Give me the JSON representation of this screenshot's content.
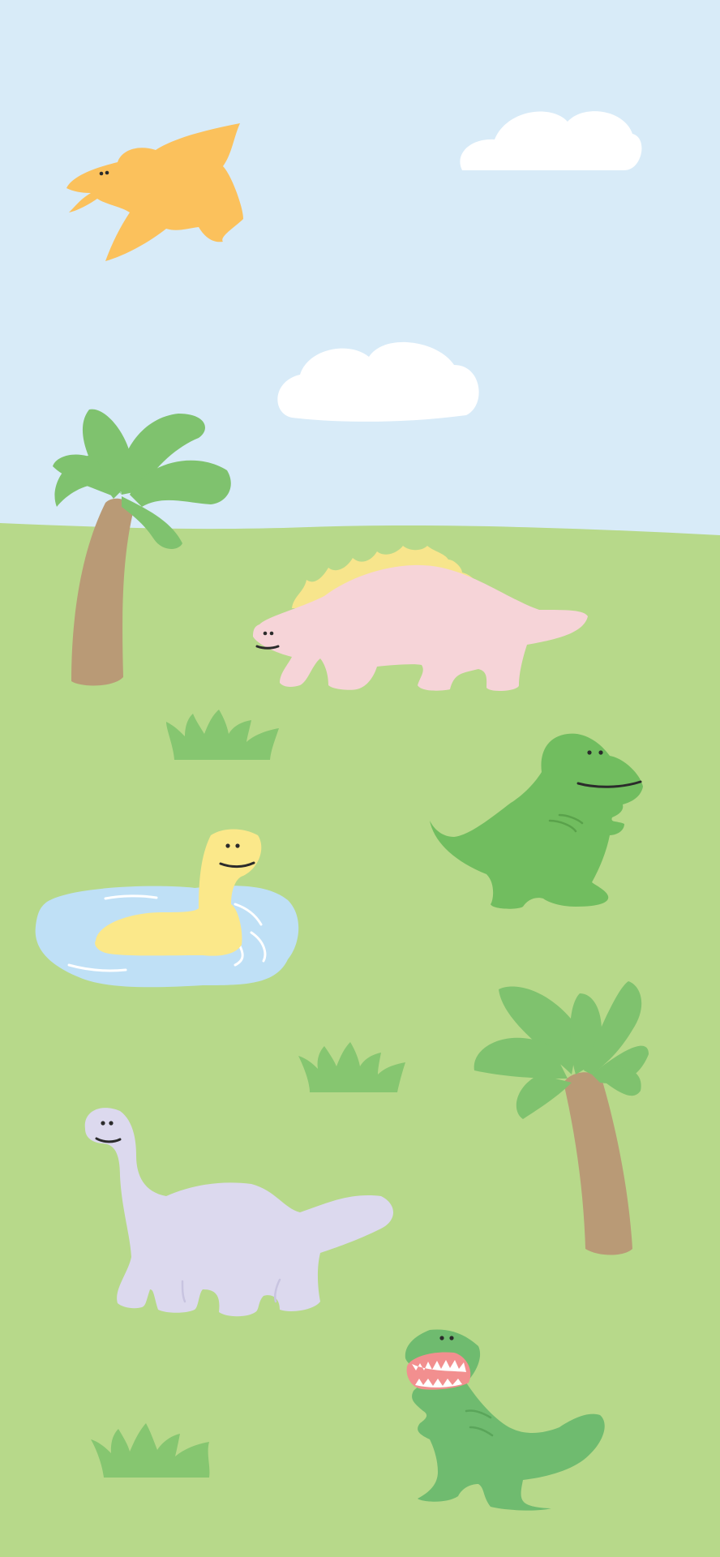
{
  "scene": {
    "colors": {
      "sky": "#d8ebf8",
      "grass": "#b7d98a",
      "cloud": "#ffffff",
      "palm_leaf": "#7fc26e",
      "palm_trunk": "#b99a76",
      "bush": "#86c670",
      "pond": "#bfe0f6",
      "pterodactyl": "#fbc15c",
      "stegosaurus": "#f6d4d8",
      "stegosaurus_plates": "#f7e58c",
      "swimming_dino": "#fbe88a",
      "trex": "#71bd5f",
      "trex_roaring": "#6fbb6f",
      "trex_mouth": "#f28f8f",
      "brachiosaurus": "#dcd9ee",
      "ink": "#2b2b2b"
    },
    "icons": [
      "pterodactyl-icon",
      "cloud-icon",
      "palm-tree-icon",
      "stegosaurus-icon",
      "bush-icon",
      "trex-icon",
      "pond-icon",
      "swimming-dino-icon",
      "brachiosaurus-icon",
      "trex-roaring-icon"
    ]
  }
}
